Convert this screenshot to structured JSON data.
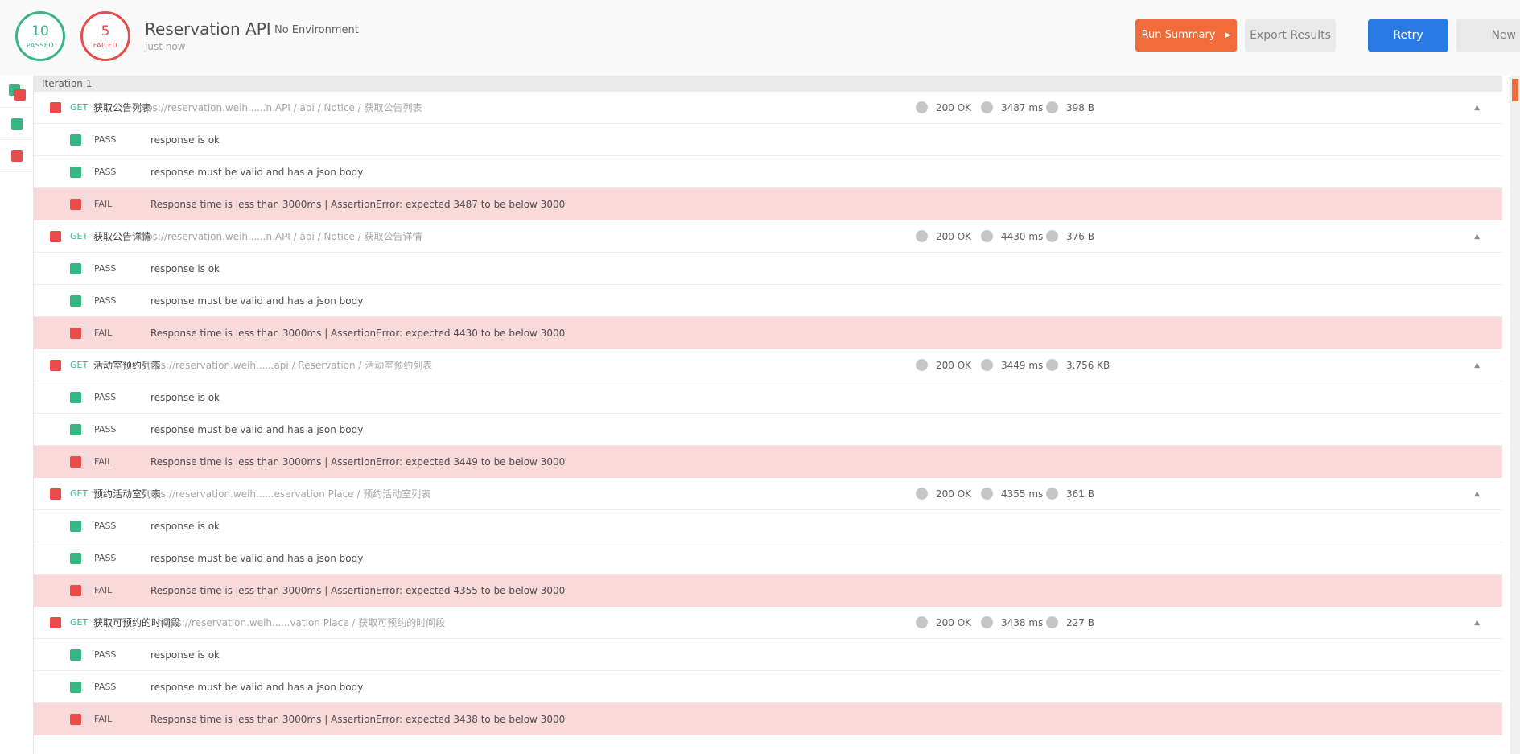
{
  "summary": {
    "passed_count": "10",
    "passed_label": "PASSED",
    "failed_count": "5",
    "failed_label": "FAILED"
  },
  "run": {
    "title": "Reservation API",
    "environment": "No Environment",
    "time": "just now"
  },
  "buttons": {
    "run_summary": "Run Summary",
    "export": "Export Results",
    "retry": "Retry",
    "new": "New"
  },
  "iteration": {
    "label": "Iteration 1"
  },
  "requests": [
    {
      "method": "GET",
      "name": "获取公告列表",
      "url": "https://reservation.weih...",
      "path": "...n API / api / Notice / 获取公告列表",
      "status": "200 OK",
      "time": "3487 ms",
      "size": "398 B",
      "tests": [
        {
          "result": "PASS",
          "message": "response is ok"
        },
        {
          "result": "PASS",
          "message": "response must be valid and has a json body"
        },
        {
          "result": "FAIL",
          "message": "Response time is less than 3000ms | AssertionError: expected 3487 to be below 3000"
        }
      ]
    },
    {
      "method": "GET",
      "name": "获取公告详情",
      "url": "https://reservation.weih...",
      "path": "...n API / api / Notice / 获取公告详情",
      "status": "200 OK",
      "time": "4430 ms",
      "size": "376 B",
      "tests": [
        {
          "result": "PASS",
          "message": "response is ok"
        },
        {
          "result": "PASS",
          "message": "response must be valid and has a json body"
        },
        {
          "result": "FAIL",
          "message": "Response time is less than 3000ms | AssertionError: expected 4430 to be below 3000"
        }
      ]
    },
    {
      "method": "GET",
      "name": "活动室预约列表",
      "url": "https://reservation.weih...",
      "path": "...api / Reservation / 活动室预约列表",
      "status": "200 OK",
      "time": "3449 ms",
      "size": "3.756 KB",
      "tests": [
        {
          "result": "PASS",
          "message": "response is ok"
        },
        {
          "result": "PASS",
          "message": "response must be valid and has a json body"
        },
        {
          "result": "FAIL",
          "message": "Response time is less than 3000ms | AssertionError: expected 3449 to be below 3000"
        }
      ]
    },
    {
      "method": "GET",
      "name": "预约活动室列表",
      "url": "https://reservation.weih...",
      "path": "...eservation Place / 预约活动室列表",
      "status": "200 OK",
      "time": "4355 ms",
      "size": "361 B",
      "tests": [
        {
          "result": "PASS",
          "message": "response is ok"
        },
        {
          "result": "PASS",
          "message": "response must be valid and has a json body"
        },
        {
          "result": "FAIL",
          "message": "Response time is less than 3000ms | AssertionError: expected 4355 to be below 3000"
        }
      ]
    },
    {
      "method": "GET",
      "name": "获取可预约的时间段",
      "url": "https://reservation.weih...",
      "path": "...vation Place / 获取可预约的时间段",
      "status": "200 OK",
      "time": "3438 ms",
      "size": "227 B",
      "tests": [
        {
          "result": "PASS",
          "message": "response is ok"
        },
        {
          "result": "PASS",
          "message": "response must be valid and has a json body"
        },
        {
          "result": "FAIL",
          "message": "Response time is less than 3000ms | AssertionError: expected 3438 to be below 3000"
        }
      ]
    }
  ],
  "colors": {
    "pass": "#37b582",
    "fail": "#e84c4c",
    "accent": "#f26b3a",
    "primary": "#2a7ae4",
    "fail_row_bg": "#f9d9d9"
  }
}
